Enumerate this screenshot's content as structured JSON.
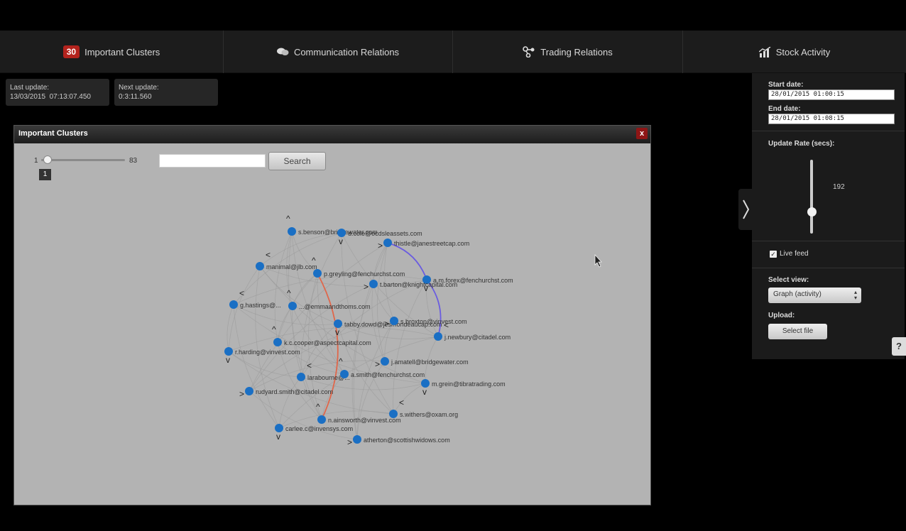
{
  "tabs": [
    {
      "label": "Important Clusters",
      "badge": "30",
      "icon": "clusters-badge"
    },
    {
      "label": "Communication Relations",
      "icon": "chat-bubbles-icon"
    },
    {
      "label": "Trading Relations",
      "icon": "network-nodes-icon"
    },
    {
      "label": "Stock Activity",
      "icon": "chart-icon"
    }
  ],
  "status": {
    "last_update_label": "Last update:",
    "last_update_value": "13/03/2015  07:13:07.450",
    "next_update_label": "Next update:",
    "next_update_value": "0:3:11.560"
  },
  "window": {
    "title": "Important Clusters",
    "close": "x",
    "slider_min": "1",
    "slider_max": "83",
    "slider_value": "1",
    "search_value": "",
    "search_label": "Search"
  },
  "graph": {
    "nodes": [
      {
        "id": "benson",
        "label": "s.benson@bridgewater.com"
      },
      {
        "id": "ocds",
        "label": "d.cole@ocdsleassets.com"
      },
      {
        "id": "thistle",
        "label": "thistle@janestreetcap.com"
      },
      {
        "id": "manimal",
        "label": "manimal@jlb.com"
      },
      {
        "id": "greyling",
        "label": "p.greyling@fenchurchst.com"
      },
      {
        "id": "forex",
        "label": "a.m.forex@fenchurchst.com"
      },
      {
        "id": "tbarton",
        "label": "t.barton@knightcapital.com"
      },
      {
        "id": "hastings",
        "label": "g.hastings@..."
      },
      {
        "id": "mma",
        "label": "...@emmaandthoms.com"
      },
      {
        "id": "tabby",
        "label": "tabby.dowd@jesmondeaucap.com"
      },
      {
        "id": "broxton",
        "label": "s.broxton@vinvest.com"
      },
      {
        "id": "newbury",
        "label": "j.newbury@citadel.com"
      },
      {
        "id": "kccooper",
        "label": "k.c.cooper@aspectcapital.com"
      },
      {
        "id": "harding",
        "label": "r.harding@vinvest.com"
      },
      {
        "id": "amatell",
        "label": "j.amatell@bridgewater.com"
      },
      {
        "id": "larabourne",
        "label": "larabourne@..."
      },
      {
        "id": "asmith",
        "label": "a.smith@fenchurchst.com"
      },
      {
        "id": "grein",
        "label": "m.grein@tibratrading.com"
      },
      {
        "id": "rudyard",
        "label": "rudyard.smith@citadel.com"
      },
      {
        "id": "withers",
        "label": "s.withers@oxam.org"
      },
      {
        "id": "ainsworth",
        "label": "n.ainsworth@vinvest.com"
      },
      {
        "id": "carlee",
        "label": "carlee.c@invensys.com"
      },
      {
        "id": "atherton",
        "label": "atherton@scottishwidows.com"
      }
    ],
    "highlight_edges": [
      {
        "from": "thistle",
        "to": "forex",
        "color": "#6a5ce0"
      },
      {
        "from": "forex",
        "to": "newbury",
        "color": "#6a5ce0"
      },
      {
        "from": "greyling",
        "to": "ainsworth",
        "color": "#e0664a"
      }
    ]
  },
  "side_panel": {
    "start_label": "Start date:",
    "start_value": "28/01/2015 01:00:15",
    "end_label": "End date:",
    "end_value": "28/01/2015 01:08:15",
    "rate_label": "Update Rate (secs):",
    "rate_value": "192",
    "rate_fraction": 0.3,
    "live_feed_label": "Live feed",
    "live_feed_checked": true,
    "view_label": "Select view:",
    "view_value": "Graph (activity)",
    "upload_label": "Upload:",
    "select_file_label": "Select file"
  },
  "help_label": "?",
  "colors": {
    "node": "#1a6fc4",
    "panel": "#1b1b1b",
    "canvas": "#b3b3b3"
  }
}
